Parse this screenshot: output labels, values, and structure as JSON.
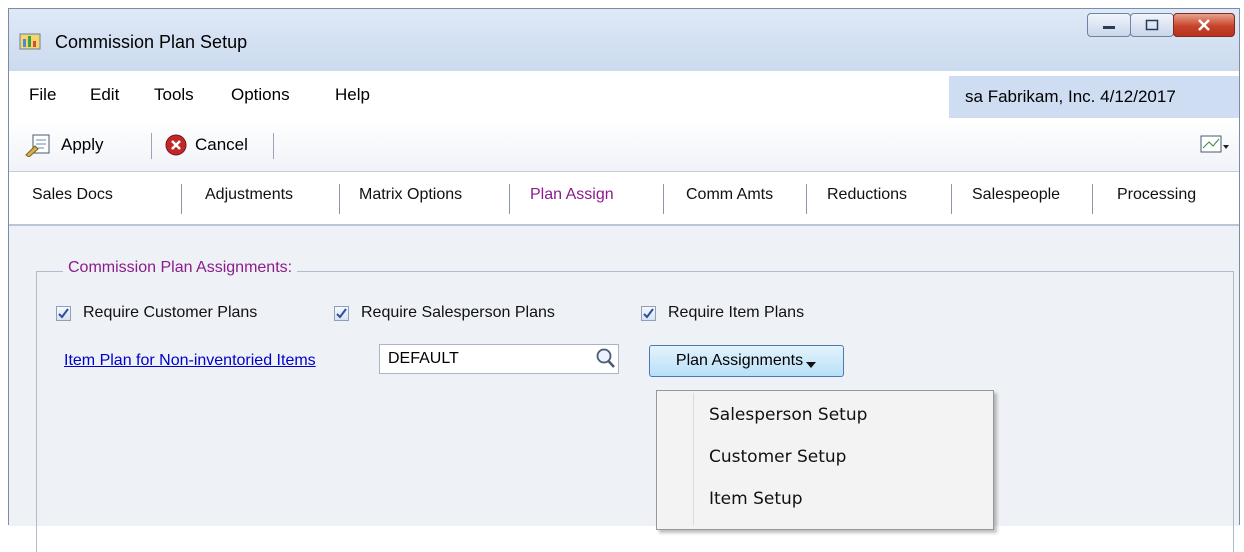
{
  "window": {
    "title": "Commission Plan Setup"
  },
  "menu": {
    "items": [
      "File",
      "Edit",
      "Tools",
      "Options",
      "Help"
    ]
  },
  "userinfo": {
    "user": "sa",
    "company": "Fabrikam, Inc.",
    "date": "4/12/2017"
  },
  "toolbar": {
    "apply_label": "Apply",
    "cancel_label": "Cancel"
  },
  "tabs": [
    "Sales Docs",
    "Adjustments",
    "Matrix Options",
    "Plan Assign",
    "Comm Amts",
    "Reductions",
    "Salespeople",
    "Processing"
  ],
  "active_tab": "Plan Assign",
  "group": {
    "title": "Commission Plan Assignments:",
    "checkboxes": [
      {
        "label": "Require Customer Plans",
        "checked": true
      },
      {
        "label": "Require Salesperson Plans",
        "checked": true
      },
      {
        "label": "Require Item Plans",
        "checked": true
      }
    ],
    "item_plan_label": "Item Plan for Non-inventoried Items",
    "item_plan_value": "DEFAULT",
    "plan_button_label": "Plan Assignments"
  },
  "dropdown": {
    "items": [
      "Salesperson Setup",
      "Customer Setup",
      "Item Setup"
    ]
  },
  "colors": {
    "accent_purple": "#8b1c8b",
    "link_blue": "#0000cc",
    "userinfo_bg": "#cfddf3",
    "close_red": "#c7432b"
  }
}
